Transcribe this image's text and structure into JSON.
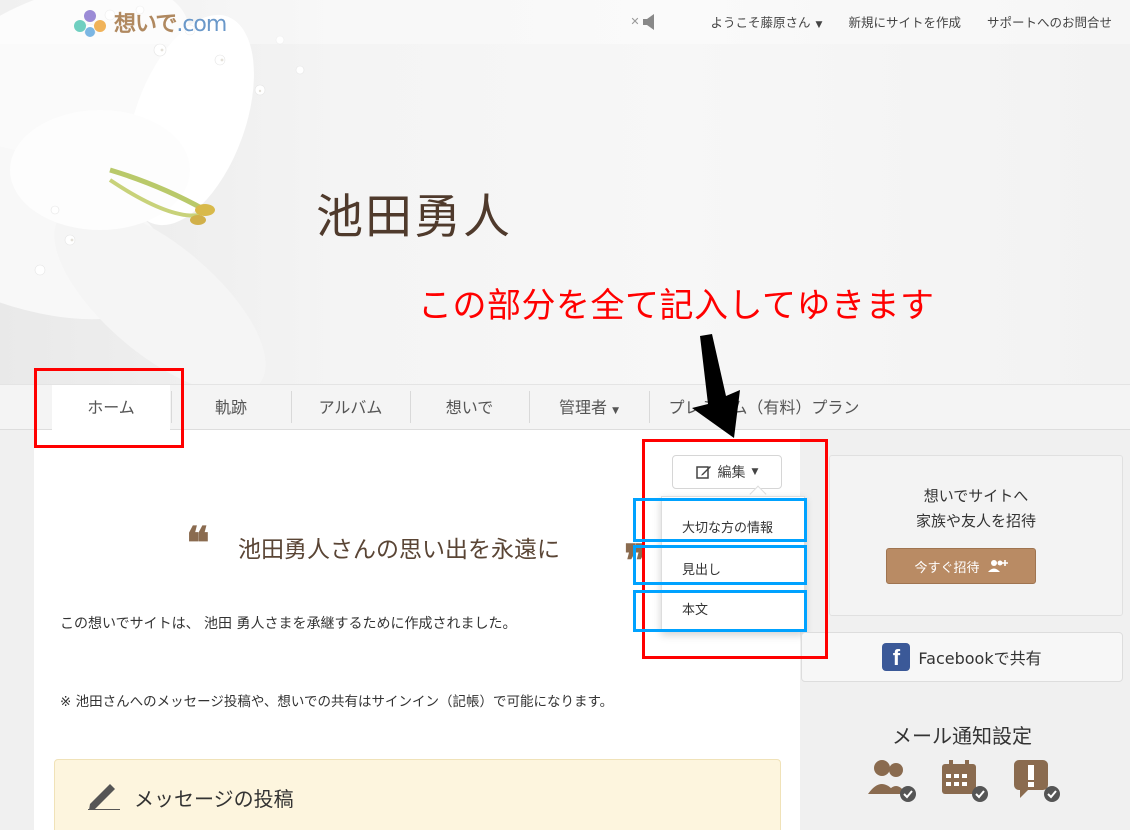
{
  "header": {
    "logo_text": "想いで",
    "logo_domain": ".com",
    "mute_label": "✕",
    "user_greeting": "ようこそ藤原さん",
    "create_site": "新規にサイトを作成",
    "support": "サポートへのお問合せ"
  },
  "hero": {
    "title": "池田勇人",
    "annotation": "この部分を全て記入してゆきます"
  },
  "tabs": {
    "home": "ホーム",
    "timeline": "軌跡",
    "album": "アルバム",
    "memories": "想いで",
    "admin": "管理者",
    "premium": "プレミアム（有料）プラン"
  },
  "main": {
    "edit_label": "編集",
    "dropdown": {
      "item1": "大切な方の情報",
      "item2": "見出し",
      "item3": "本文"
    },
    "quote": "池田勇人さんの思い出を永遠に",
    "quote_open": "❝",
    "quote_close": "❞",
    "description": "この想いでサイトは、 池田 勇人さまを承継するために作成されました。",
    "notice": "※ 池田さんへのメッセージ投稿や、想いでの共有はサインイン（記帳）で可能になります。",
    "message_title": "メッセージの投稿"
  },
  "sidebar": {
    "invite_line1": "想いでサイトへ",
    "invite_line2": "家族や友人を招待",
    "invite_button": "今すぐ招待",
    "facebook_label": "Facebookで共有",
    "facebook_glyph": "f",
    "mail_title": "メール通知設定"
  },
  "colors": {
    "accent": "#b98b64",
    "title": "#4f3a2c",
    "annotation_red": "#ff0000",
    "annotation_blue": "#00a2ff",
    "facebook": "#3b5998"
  }
}
